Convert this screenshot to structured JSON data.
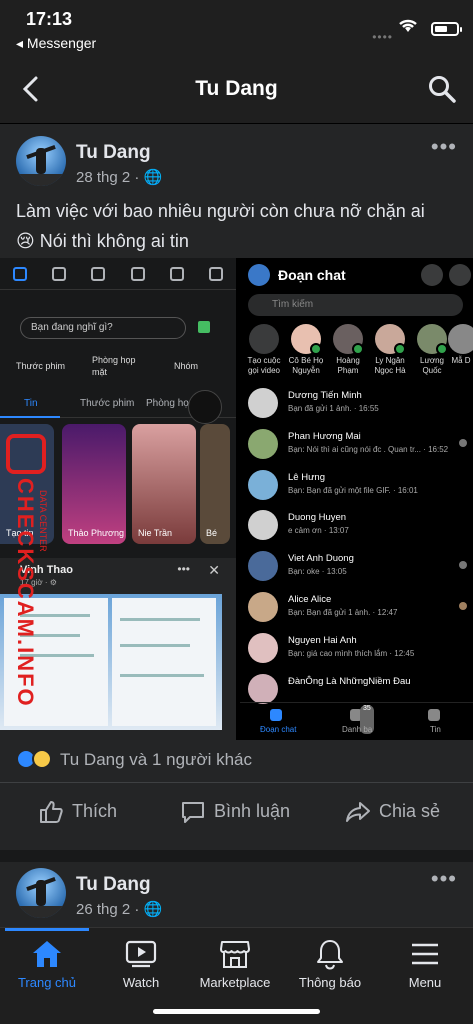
{
  "status": {
    "time": "17:13",
    "back_app": "◂ Messenger"
  },
  "nav": {
    "title": "Tu Dang"
  },
  "post": {
    "author": "Tu Dang",
    "date": "28 thg 2 ·",
    "text_line1": "Làm việc với bao nhiêu người còn chưa nỡ chặn ai",
    "text_line2": "😢 Nói thì không ai tin",
    "reactions_text": "Tu Dang và 1 người khác",
    "actions": {
      "like": "Thích",
      "comment": "Bình luận",
      "share": "Chia sẻ"
    }
  },
  "screenshot_left": {
    "composer_placeholder": "Bạn đang nghĩ gì?",
    "quick": [
      "Thước phim",
      "Phòng họp\nmặt",
      "Nhóm"
    ],
    "tabs": [
      "Tin",
      "Thước phim",
      "Phòng họp mặt"
    ],
    "stories": [
      "Tạo tin",
      "Thảo Phương",
      "Nie Trần",
      "Bé"
    ],
    "post_name": "Vinh Thao",
    "post_time": "17 giờ · ⚙",
    "watermark": "CHECKSCAM.INFO",
    "watermark_small": "DATA CENTER"
  },
  "screenshot_right": {
    "title": "Đoạn chat",
    "search_placeholder": "Tìm kiếm",
    "stories": [
      {
        "label": "Tạo cuộc gọi video"
      },
      {
        "label": "Cô Bé Họ Nguyễn"
      },
      {
        "label": "Hoàng Phạm"
      },
      {
        "label": "Ly Ngân Ngọc Hà"
      },
      {
        "label": "Lương Quốc"
      },
      {
        "label": "Mẫ D"
      }
    ],
    "chats": [
      {
        "name": "Dương Tiến Minh",
        "preview": "Bạn đã gửi 1 ảnh. · 16:55"
      },
      {
        "name": "Phan Hương Mai",
        "preview": "Bạn: Nói thì ai cũng nói đc . Quan tr... · 16:52"
      },
      {
        "name": "Lê Hưng",
        "preview": "Bạn: Bạn đã gửi một file GIF. · 16:01"
      },
      {
        "name": "Duong Huyen",
        "preview": "e cảm ơn · 13:07"
      },
      {
        "name": "Viet Anh Duong",
        "preview": "Bạn: oke · 13:05"
      },
      {
        "name": "Alice Alice",
        "preview": "Bạn: Bạn đã gửi 1 ảnh. · 12:47"
      },
      {
        "name": "Nguyen Hai Anh",
        "preview": "Bạn: giá cao mình thích lắm · 12:45"
      },
      {
        "name": "ĐànÔng Là NhữngNiềm Đau",
        "preview": ""
      }
    ],
    "tabs": [
      "Đoạn chat",
      "Danh bạ",
      "Tin"
    ],
    "badge": "35"
  },
  "post2": {
    "author": "Tu Dang",
    "date": "26 thg 2 ·"
  },
  "tabbar": {
    "items": [
      "Trang chủ",
      "Watch",
      "Marketplace",
      "Thông báo",
      "Menu"
    ]
  },
  "colors": {
    "accent": "#2d88ff",
    "bg": "#242526",
    "bar": "#1f1f1f"
  }
}
